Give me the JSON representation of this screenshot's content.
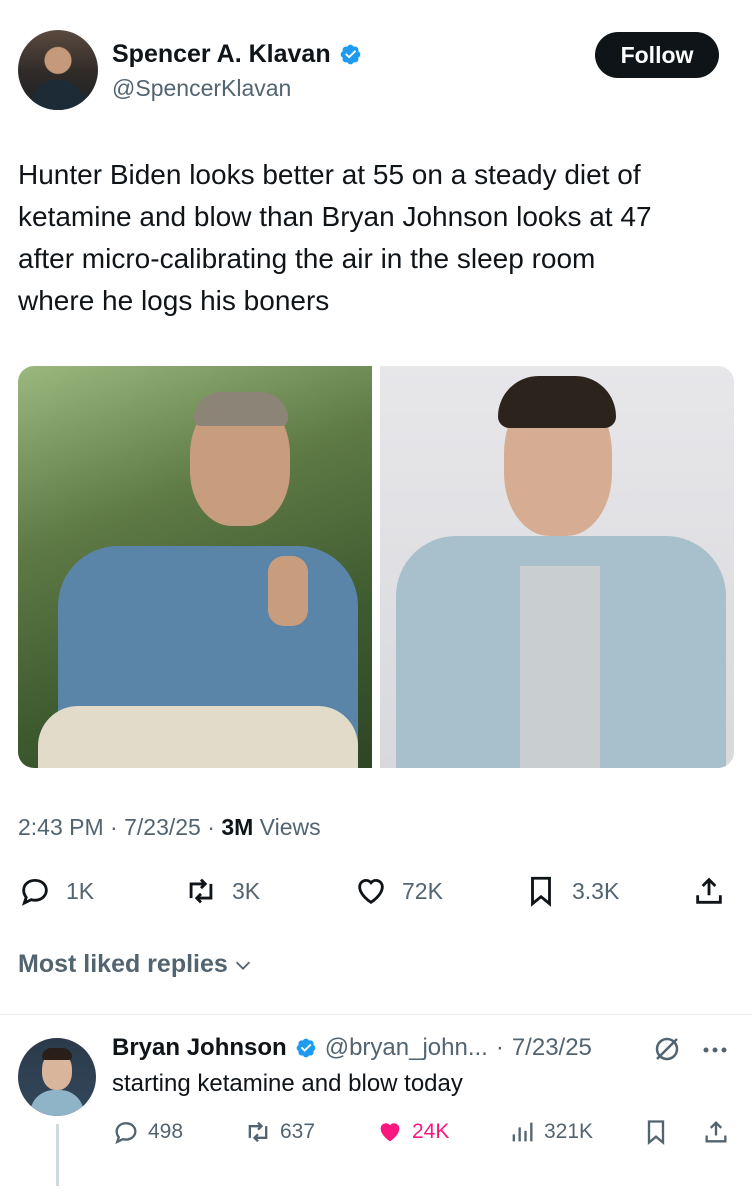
{
  "author": {
    "name": "Spencer A. Klavan",
    "handle": "@SpencerKlavan",
    "verified": true
  },
  "follow_label": "Follow",
  "tweet": {
    "text_lines": [
      "Hunter Biden looks better at 55 on a steady diet of",
      "ketamine and blow than Bryan Johnson looks at 47",
      "after micro-calibrating the air in the sleep room",
      "where he logs his boners"
    ]
  },
  "meta": {
    "time": "2:43 PM",
    "sep1": " · ",
    "date": "7/23/25",
    "sep2": " · ",
    "views_count": "3M",
    "views_label": " Views"
  },
  "actions": {
    "replies": "1K",
    "reposts": "3K",
    "likes": "72K",
    "bookmarks": "3.3K"
  },
  "most_liked_label": "Most liked replies",
  "reply": {
    "name": "Bryan Johnson",
    "handle": "@bryan_john...",
    "sep": "·",
    "date": "7/23/25",
    "text": "starting ketamine and blow today",
    "replies": "498",
    "reposts": "637",
    "likes": "24K",
    "views": "321K"
  },
  "colors": {
    "text": "#0f1419",
    "secondary": "#536471",
    "verified_blue": "#1d9bf0",
    "like_pink": "#f91880"
  },
  "icons": [
    "verified-badge-icon",
    "reply-icon",
    "repost-icon",
    "like-icon",
    "bookmark-icon",
    "share-icon",
    "chevron-down-icon",
    "grok-icon",
    "more-icon",
    "views-icon"
  ]
}
